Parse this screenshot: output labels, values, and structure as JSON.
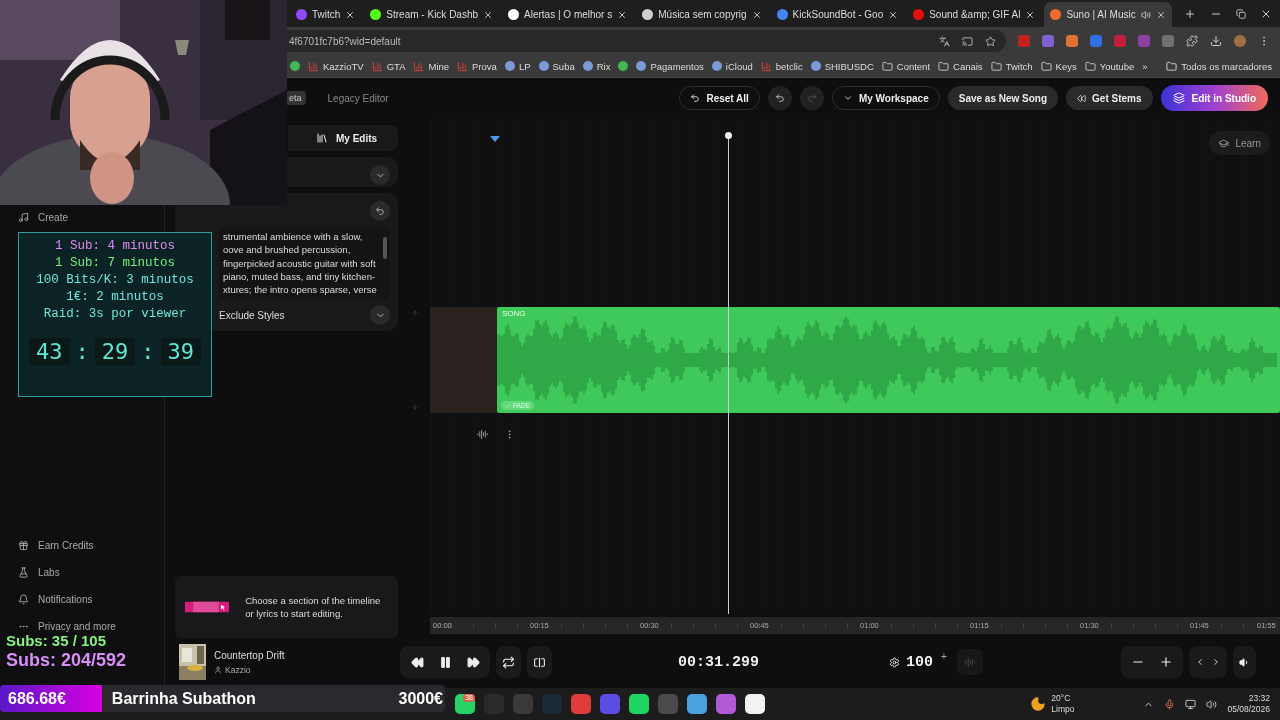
{
  "browser": {
    "tabs": [
      {
        "title": "Twitch",
        "color": "#9146ff",
        "selected": false
      },
      {
        "title": "Stream - Kick Dashb",
        "color": "#53fc18",
        "selected": false
      },
      {
        "title": "Alertas | O melhor s",
        "color": "#ffffff",
        "selected": false
      },
      {
        "title": "Música sem copyrig",
        "color": "#d0d0d0",
        "selected": false
      },
      {
        "title": "KickSoundBot - Goo",
        "color": "#4285f4",
        "selected": false
      },
      {
        "title": "Sound &amp; GIF Al",
        "color": "#e01010",
        "selected": false
      },
      {
        "title": "Suno | AI Music",
        "color": "#f06a2a",
        "selected": true
      }
    ],
    "address": "4f6701fc7b6?wid=default",
    "bookmarks": [
      {
        "kind": "app"
      },
      {
        "kind": "chart",
        "label": "KazzioTV"
      },
      {
        "kind": "chart",
        "label": "GTA"
      },
      {
        "kind": "chart",
        "label": "Mine"
      },
      {
        "kind": "chart",
        "label": "Prova"
      },
      {
        "kind": "site",
        "label": "LP"
      },
      {
        "kind": "site",
        "label": "Suba"
      },
      {
        "kind": "site",
        "label": "Rix"
      },
      {
        "kind": "app"
      },
      {
        "kind": "site",
        "label": "Pagamentos"
      },
      {
        "kind": "site",
        "label": "iCloud"
      },
      {
        "kind": "chart",
        "label": "betclic"
      },
      {
        "kind": "site",
        "label": "SHIBUSDC"
      },
      {
        "kind": "folder",
        "label": "Content"
      },
      {
        "kind": "folder",
        "label": "Canais"
      },
      {
        "kind": "folder",
        "label": "Twitch"
      },
      {
        "kind": "folder",
        "label": "Keys"
      },
      {
        "kind": "folder",
        "label": "Youtube"
      }
    ],
    "overflow": "»",
    "all_bookmarks": "Todos os marcadores"
  },
  "sidebar": {
    "top_items": [
      {
        "kind": "create",
        "label": "Create"
      }
    ],
    "bottom_items": [
      {
        "kind": "credits",
        "label": "Earn Credits"
      },
      {
        "kind": "labs",
        "label": "Labs"
      },
      {
        "kind": "notifications",
        "label": "Notifications"
      },
      {
        "kind": "more",
        "label": "Privacy and more"
      }
    ]
  },
  "toolbar": {
    "badge": "eta",
    "legacy": "Legacy Editor",
    "reset": "Reset All",
    "workspace": "My Workspace",
    "save": "Save as New Song",
    "stems": "Get Stems",
    "studio": "Edit in Studio"
  },
  "panel": {
    "tab": "My Edits",
    "styles_lines": [
      "strumental ambience with a slow,",
      "oove and brushed percussion,",
      "fingerpicked acoustic guitar with soft",
      "piano, muted bass, and tiny kitchen-",
      "xtures; the intro opens sparse, verse"
    ],
    "exclude": "Exclude Styles",
    "hint": "Choose a section of the timeline or lyrics to start editing.",
    "song": {
      "title": "Countertop Drift",
      "artist": "Kazzio"
    }
  },
  "editor": {
    "learn": "Learn",
    "clip_label": "SONG",
    "fade": "FADE",
    "ruler": [
      "00:00",
      "00:15",
      "00:30",
      "00:45",
      "01:00",
      "01:15",
      "01:30",
      "01:45",
      "01:55"
    ],
    "time": "00:31.299",
    "bpm": "100",
    "step": "+"
  },
  "overlay": {
    "rates": [
      {
        "text": "1 Sub: 4 minutos",
        "color": "#e58af0"
      },
      {
        "text": "1 Sub: 7 minutos",
        "color": "#74f07a"
      },
      {
        "text": "100 Bits/K: 3 minutos",
        "color": "#6ee8dc"
      },
      {
        "text": "1€: 2 minutos",
        "color": "#6ee8dc"
      },
      {
        "text": "Raid: 3s por viewer",
        "color": "#6ee8dc"
      }
    ],
    "timer": {
      "parts": [
        "43",
        "29",
        "39"
      ],
      "separator": ":"
    },
    "subs": [
      {
        "text": "Subs: 35 / 105",
        "color": "#86f27e"
      },
      {
        "text": "Subs: 204/592",
        "color": "#d98ef5"
      }
    ],
    "bar": {
      "raised": "686.68€",
      "title": "Barrinha Subathon",
      "goal": "3000€",
      "level": 0.23
    }
  },
  "taskbar": {
    "apps": [
      {
        "color": "#25d366",
        "badge": "38"
      },
      {
        "color": "#2b2b2b"
      },
      {
        "color": "#3a3a3a"
      },
      {
        "color": "#1b2838"
      },
      {
        "color": "#e03a3a"
      },
      {
        "color": "#5b4ce6"
      },
      {
        "color": "#1ed760"
      },
      {
        "color": "#4a4a4a"
      },
      {
        "color": "#4aa3df"
      },
      {
        "color": "#b05ad8"
      },
      {
        "color": "#f2f2f2"
      }
    ],
    "weather": {
      "temp": "20°C",
      "condition": "Limpo"
    },
    "time": "23:32",
    "date": "05/08/2026"
  }
}
